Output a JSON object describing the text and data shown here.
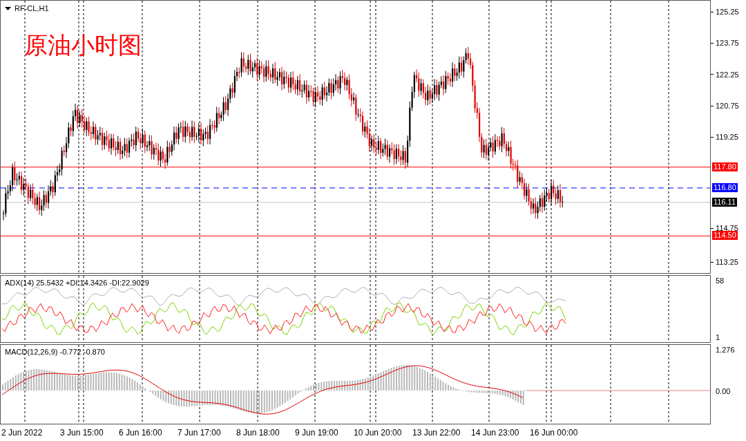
{
  "symbol": {
    "label": "RF-CL,H1"
  },
  "annotation": "原油小时图",
  "main_pane": {
    "price_ticks": [
      "125.25",
      "123.75",
      "122.25",
      "120.75",
      "119.25",
      "114.75",
      "113.25"
    ],
    "price_lines": [
      {
        "value": "117.80",
        "color": "#ff0000",
        "kind": "solid"
      },
      {
        "value": "116.80",
        "color": "#0000ff",
        "kind": "dashed"
      },
      {
        "value": "116.11",
        "color": "#000000",
        "kind": "bid"
      },
      {
        "value": "114.50",
        "color": "#ff0000",
        "kind": "solid"
      }
    ]
  },
  "adx_pane": {
    "label": "ADX(14) 25.5432 +DI:14.3426 -DI:22.9029",
    "scale_max": "58",
    "scale_min": "1"
  },
  "macd_pane": {
    "label": "MACD(12,26,9) -0.772 -0.870",
    "scale_max": "1.276",
    "scale_zero": "0.00"
  },
  "time_axis": [
    "2 Jun 2022",
    "3 Jun 15:00",
    "6 Jun 16:00",
    "7 Jun 17:00",
    "8 Jun 18:00",
    "9 Jun 19:00",
    "10 Jun 20:00",
    "13 Jun 22:00",
    "14 Jun 23:00",
    "16 Jun 00:00"
  ]
}
